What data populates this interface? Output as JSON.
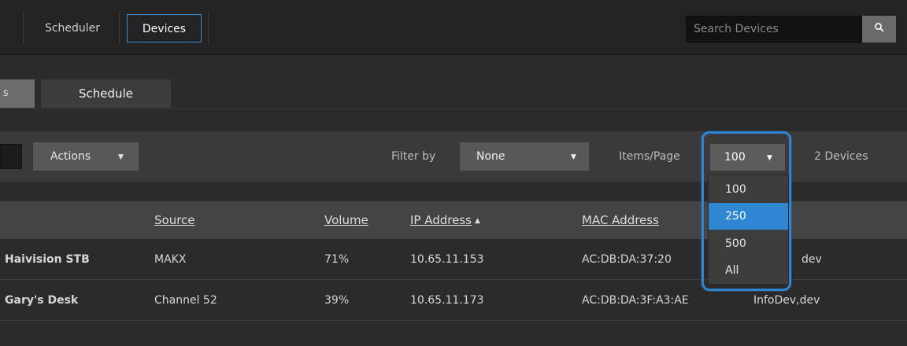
{
  "nav": {
    "items": [
      {
        "label": "Scheduler",
        "active": false
      },
      {
        "label": "Devices",
        "active": true
      }
    ],
    "search_placeholder": "Search Devices",
    "search_icon": "search-icon"
  },
  "tabs": {
    "partial_tab_label": "s",
    "items": [
      "Schedule"
    ]
  },
  "toolbar": {
    "actions_label": "Actions",
    "filter_label": "Filter by",
    "filter_value": "None",
    "items_label": "Items/Page",
    "items_value": "100",
    "device_count": "2 Devices"
  },
  "dropdown": {
    "options": [
      "100",
      "250",
      "500",
      "All"
    ],
    "highlighted": "250"
  },
  "table": {
    "headers": [
      "Source",
      "Volume",
      "IP Address",
      "MAC Address"
    ],
    "sorted_column": "IP Address",
    "sort_direction": "ascending",
    "rows": [
      {
        "name": "Haivision STB",
        "source": "MAKX",
        "volume": "71%",
        "ip": "10.65.11.153",
        "mac": "AC:DB:DA:37:20",
        "tags": "dev"
      },
      {
        "name": "Gary's Desk",
        "source": "Channel 52",
        "volume": "39%",
        "ip": "10.65.11.173",
        "mac": "AC:DB:DA:3F:A3:AE",
        "tags": "InfoDev,dev"
      }
    ]
  },
  "colors": {
    "accent": "#2f86d1",
    "background": "#2b2b2b",
    "topbar": "#232323"
  }
}
